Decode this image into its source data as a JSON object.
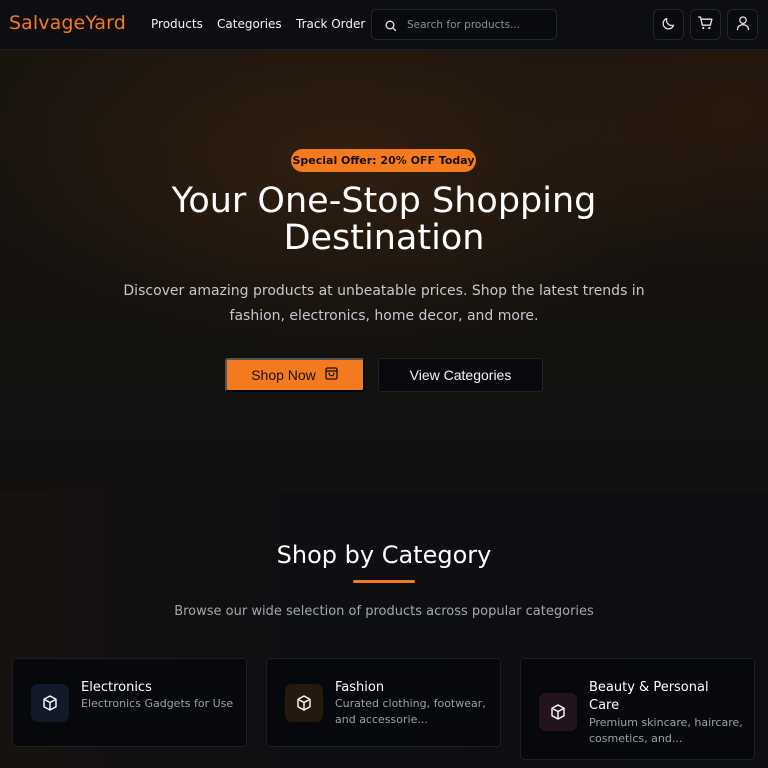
{
  "navbar": {
    "brand": "SalvageYard",
    "links": [
      "Products",
      "Categories",
      "Track Order"
    ],
    "search": {
      "placeholder": "Search for products...",
      "value": "",
      "icon": "search-icon"
    },
    "icons": [
      "moon-icon",
      "cart-icon",
      "user-icon"
    ]
  },
  "hero": {
    "badge": "Special Offer: 20% OFF Today",
    "title_line1": "Your One-Stop Shopping",
    "title_line2": "Destination",
    "description_line1": "Discover amazing products at unbeatable prices. Shop the latest trends in",
    "description_line2": "fashion, electronics, home decor, and more.",
    "primary_button": "Shop Now",
    "primary_button_icon": "shopping-bag-icon",
    "secondary_button": "View Categories"
  },
  "categories_section": {
    "title": "Shop by Category",
    "subtitle": "Browse our wide selection of products across popular categories",
    "cards": [
      {
        "name": "Electronics",
        "description": "Electronics Gadgets for Use",
        "icon": "box-icon"
      },
      {
        "name": "Fashion",
        "description": "Curated clothing, footwear, and accessorie...",
        "icon": "box-icon"
      },
      {
        "name": "Beauty & Personal Care",
        "description": "Premium skincare, haircare, cosmetics, and...",
        "icon": "box-icon"
      }
    ]
  },
  "colors": {
    "accent": "#f47a1f",
    "background": "#0b0c10",
    "card_background": "#07080b"
  }
}
